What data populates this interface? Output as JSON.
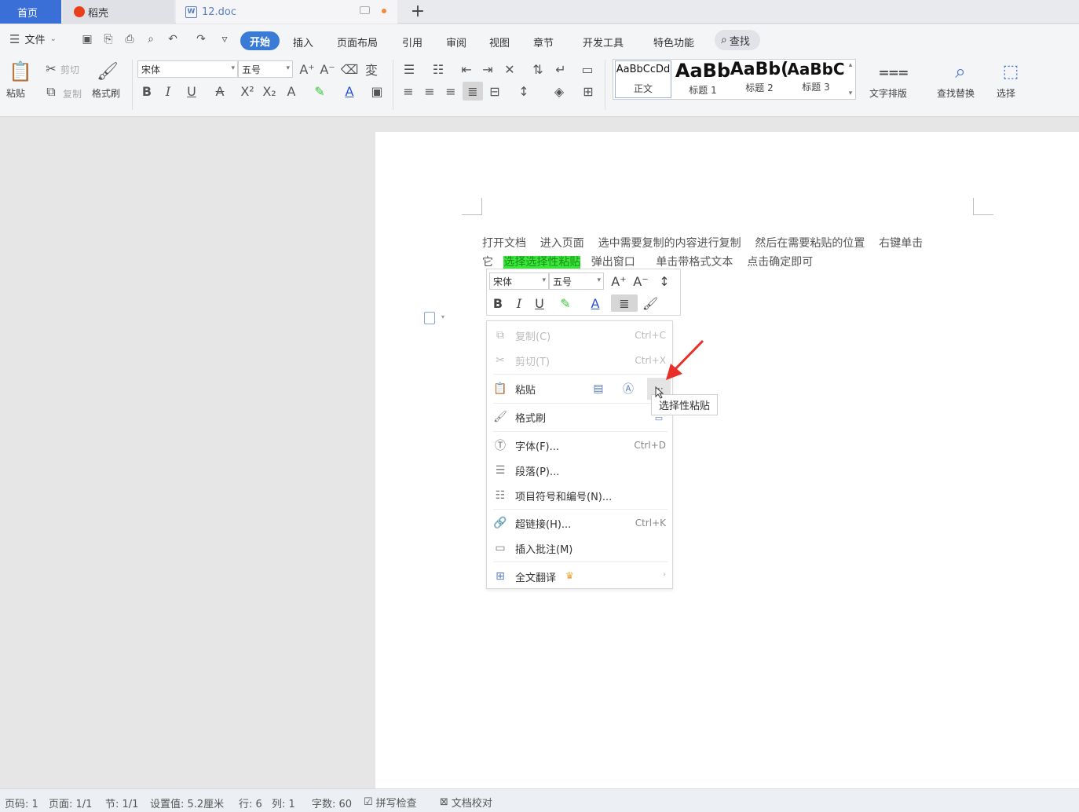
{
  "tabs": {
    "home": "首页",
    "daoke": "稻壳",
    "doc": "12.doc",
    "doc_badge": "W",
    "add": "+"
  },
  "menu": {
    "file": "文件",
    "items": [
      "开始",
      "插入",
      "页面布局",
      "引用",
      "审阅",
      "视图",
      "章节",
      "开发工具",
      "特色功能"
    ],
    "search": "查找"
  },
  "ribbon": {
    "paste": "粘贴",
    "cut": "剪切",
    "copy": "复制",
    "format_painter": "格式刷",
    "font_name": "宋体",
    "font_size": "五号",
    "styles": [
      {
        "sample": "AaBbCcDd",
        "name": "正文"
      },
      {
        "sample": "AaBb",
        "name": "标题 1"
      },
      {
        "sample": "AaBb(",
        "name": "标题 2"
      },
      {
        "sample": "AaBbC",
        "name": "标题 3"
      }
    ],
    "text_layout": "文字排版",
    "find_replace": "查找替换",
    "select": "选择"
  },
  "document": {
    "line1": "打开文档    进入页面    选中需要复制的内容进行复制    然后在需要粘贴的位置    右键单击",
    "line2_pre": "它   ",
    "line2_highlight": "选择选择性粘贴",
    "line2_post": "   弹出窗口      单击带格式文本    点击确定即可"
  },
  "mini_toolbar": {
    "font_name": "宋体",
    "font_size": "五号"
  },
  "context_menu": {
    "items": [
      {
        "label": "复制(C)",
        "shortcut": "Ctrl+C",
        "icon": "copy-icon",
        "disabled": true
      },
      {
        "label": "剪切(T)",
        "shortcut": "Ctrl+X",
        "icon": "scissors-icon",
        "disabled": true
      },
      {
        "label": "粘贴",
        "shortcut": "",
        "icon": "paste-icon",
        "disabled": false
      },
      {
        "label": "格式刷",
        "shortcut": "",
        "icon": "brush-icon",
        "disabled": false
      },
      {
        "label": "字体(F)...",
        "shortcut": "Ctrl+D",
        "icon": "font-icon",
        "disabled": false
      },
      {
        "label": "段落(P)...",
        "shortcut": "",
        "icon": "paragraph-icon",
        "disabled": false
      },
      {
        "label": "项目符号和编号(N)...",
        "shortcut": "",
        "icon": "list-icon",
        "disabled": false
      },
      {
        "label": "超链接(H)...",
        "shortcut": "Ctrl+K",
        "icon": "link-icon",
        "disabled": false
      },
      {
        "label": "插入批注(M)",
        "shortcut": "",
        "icon": "comment-icon",
        "disabled": false
      },
      {
        "label": "全文翻译",
        "shortcut": "",
        "icon": "translate-icon",
        "disabled": false
      }
    ],
    "paste_more": "···"
  },
  "tooltip": "选择性粘贴",
  "status": {
    "page_code": "页码: 1",
    "page": "页面: 1/1",
    "section": "节: 1/1",
    "setting": "设置值: 5.2厘米",
    "row": "行: 6",
    "col": "列: 1",
    "words": "字数: 60",
    "spell": "拼写检查",
    "proof": "文档校对"
  },
  "colors": {
    "accent": "#3a7bd5",
    "home_tab": "#3a6fd8",
    "highlight": "#39e639",
    "arrow": "#e8302a",
    "crown": "#f2a12e"
  }
}
